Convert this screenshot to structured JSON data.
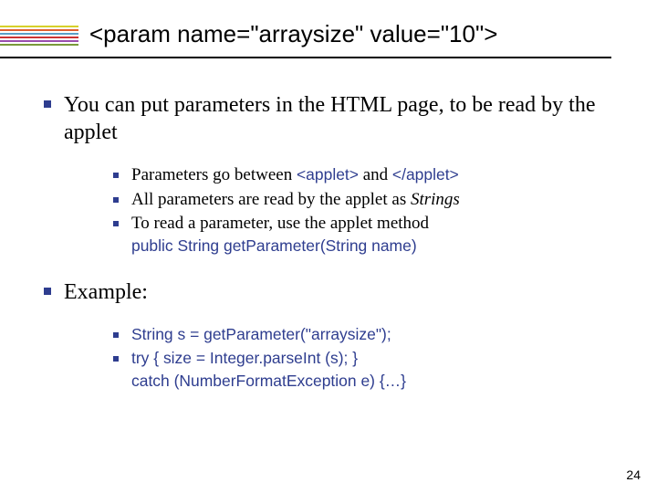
{
  "colors": {
    "accent": "#2e3d8f"
  },
  "title": "<param name=\"arraysize\" value=\"10\">",
  "bullets": {
    "b1": "You can put parameters in the HTML page, to be read by the applet",
    "b1a_pre": "Parameters go between ",
    "b1a_code1": "<applet>",
    "b1a_mid": " and ",
    "b1a_code2": "</applet>",
    "b1b_pre": "All parameters are read by the applet as ",
    "b1b_em": "Strings",
    "b1c": "To read a parameter, use the applet method",
    "b1c_code": "public String getParameter(String name)",
    "b2": "Example:",
    "b2a": "String s = getParameter(\"arraysize\");",
    "b2b_l1": "try { size = Integer.parseInt (s); }",
    "b2b_l2": "catch (NumberFormatException e) {…}"
  },
  "page_number": "24",
  "stripe_colors": [
    "#d6d02a",
    "#e06030",
    "#5aa0c8",
    "#cc3333",
    "#9a4fae",
    "#7a9a3a"
  ]
}
